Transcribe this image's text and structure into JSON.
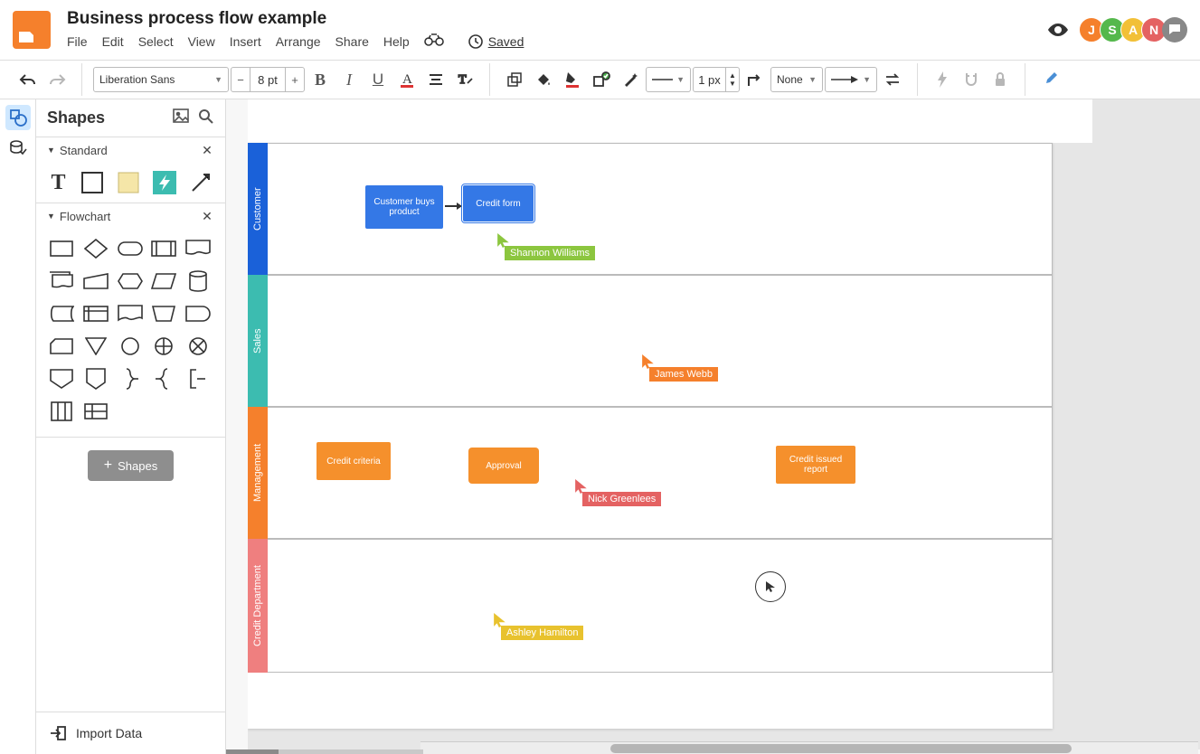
{
  "header": {
    "title": "Business process flow example",
    "menu": [
      "File",
      "Edit",
      "Select",
      "View",
      "Insert",
      "Arrange",
      "Share",
      "Help"
    ],
    "saved_label": "Saved",
    "avatars": [
      {
        "initial": "J",
        "color": "#f5802c"
      },
      {
        "initial": "S",
        "color": "#55b84c"
      },
      {
        "initial": "A",
        "color": "#f2c037"
      },
      {
        "initial": "N",
        "color": "#e46262"
      }
    ]
  },
  "toolbar": {
    "font_family": "Liberation Sans",
    "font_size": "8 pt",
    "line_width": "1 px",
    "line_type": "None"
  },
  "sidebar": {
    "title": "Shapes",
    "sections": {
      "standard": "Standard",
      "flowchart": "Flowchart"
    },
    "add_shapes_label": "Shapes",
    "import_label": "Import Data"
  },
  "canvas": {
    "lanes": {
      "customer": "Customer",
      "sales": "Sales",
      "management": "Management",
      "credit": "Credit Department"
    },
    "nodes": {
      "buy": "Customer buys product",
      "credit_form": "Credit form",
      "criteria": "Credit criteria",
      "approval": "Approval",
      "issued": "Credit issued report"
    },
    "collaborators": {
      "shannon": "Shannon Williams",
      "james": "James Webb",
      "nick": "Nick Greenlees",
      "ashley": "Ashley Hamilton"
    }
  }
}
